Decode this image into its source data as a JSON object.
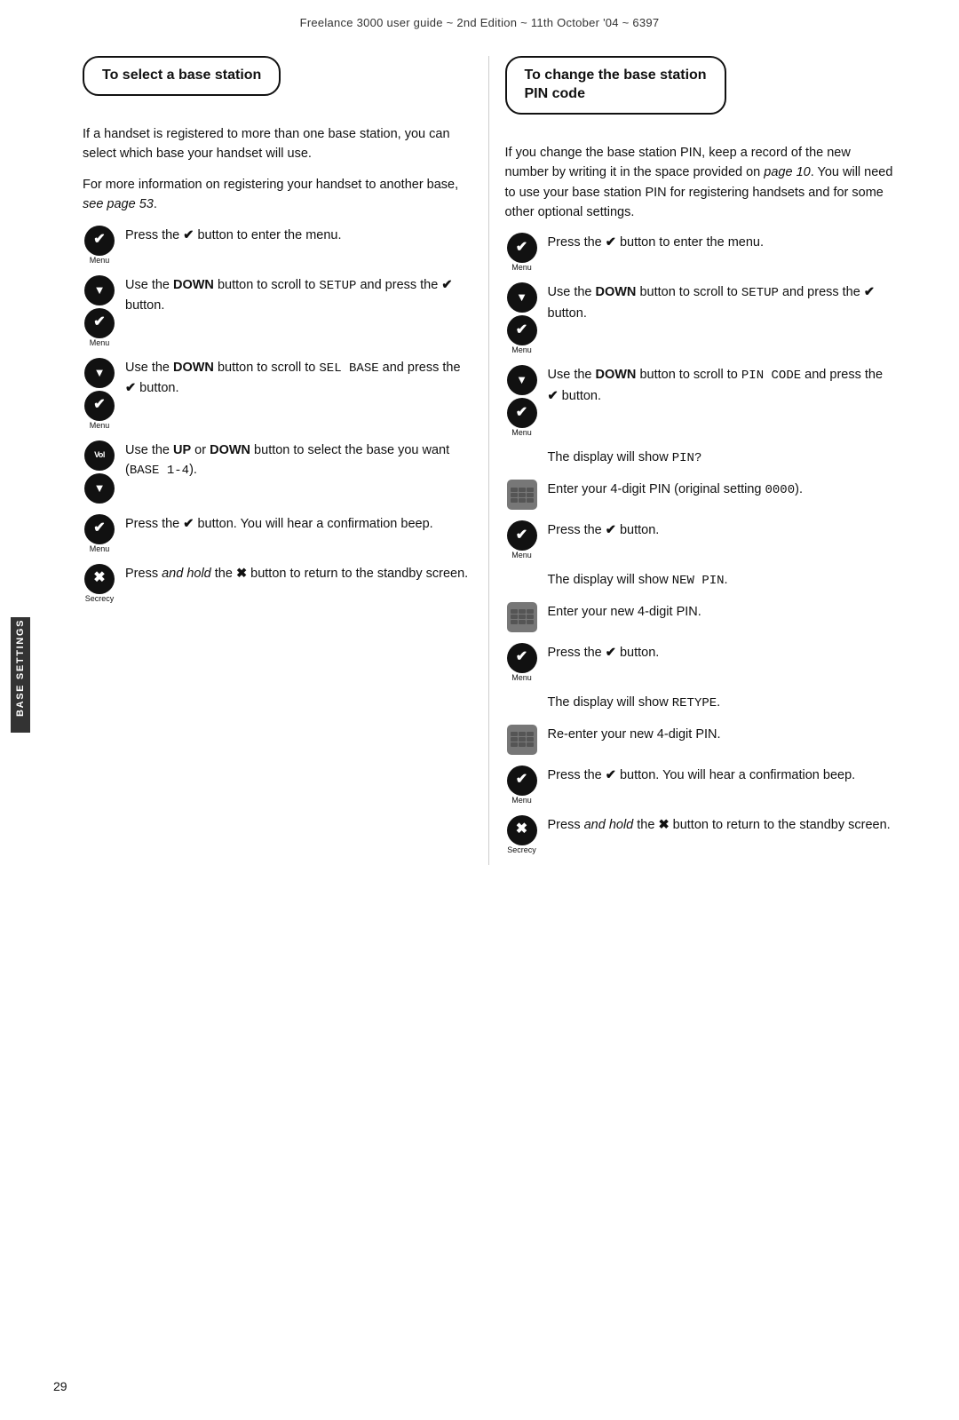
{
  "header": {
    "text": "Freelance 3000 user guide ~ 2nd Edition ~ 11th October '04 ~ 6397"
  },
  "side_tab": {
    "label": "BASE SETTINGS"
  },
  "page_number": "29",
  "left": {
    "title": "To select a base station",
    "intro1": "If a handset is registered to more than one base station, you can select which base your handset will use.",
    "intro2": "For more information on registering your handset to another base, see page 53.",
    "steps": [
      {
        "icon": "checkmark",
        "label": "Menu",
        "text": "Press the ✔ button to enter the menu."
      },
      {
        "icon": "down+checkmark",
        "label": "Menu",
        "text": "Use the DOWN button to scroll to SETUP and press the ✔ button."
      },
      {
        "icon": "down+checkmark",
        "label": "Menu",
        "text": "Use the DOWN button to scroll to SEL BASE and press the ✔ button."
      },
      {
        "icon": "vol+down",
        "label": "",
        "text": "Use the UP or DOWN button to select the base you want (BASE 1-4)."
      },
      {
        "icon": "checkmark",
        "label": "Menu",
        "text": "Press the ✔ button. You will hear a confirmation beep."
      },
      {
        "icon": "cross",
        "label": "Secrecy",
        "text": "Press and hold the ✖ button to return to the standby screen."
      }
    ],
    "see_page": "see page 53",
    "step2_mono": "SETUP",
    "step3_mono": "SEL BASE",
    "step4_mono": "BASE 1-4"
  },
  "right": {
    "title": "To change the base station PIN code",
    "intro": "If you change the base station PIN, keep a record of the new number by writing it in the space provided on page 10. You will need to use your base station PIN for registering handsets and for some other optional settings.",
    "steps": [
      {
        "icon": "checkmark",
        "label": "Menu",
        "text": "Press the ✔ button to enter the menu."
      },
      {
        "icon": "down+checkmark",
        "label": "Menu",
        "text": "Use the DOWN button to scroll to SETUP and press the ✔ button."
      },
      {
        "icon": "down+checkmark",
        "label": "Menu",
        "text": "Use the DOWN button to scroll to PIN CODE and press the ✔ button."
      },
      {
        "icon": "none",
        "label": "",
        "text": "The display will show PIN?"
      },
      {
        "icon": "keypad",
        "label": "",
        "text": "Enter your 4-digit PIN (original setting 0000)."
      },
      {
        "icon": "checkmark",
        "label": "Menu",
        "text": "Press the ✔ button."
      },
      {
        "icon": "none",
        "label": "",
        "text": "The display will show NEW PIN."
      },
      {
        "icon": "keypad",
        "label": "",
        "text": "Enter your new 4-digit PIN."
      },
      {
        "icon": "checkmark",
        "label": "Menu",
        "text": "Press the ✔ button."
      },
      {
        "icon": "none",
        "label": "",
        "text": "The display will show RETYPE."
      },
      {
        "icon": "keypad",
        "label": "",
        "text": "Re-enter your new 4-digit PIN."
      },
      {
        "icon": "checkmark",
        "label": "Menu",
        "text": "Press the ✔ button. You will hear a confirmation beep."
      },
      {
        "icon": "cross",
        "label": "Secrecy",
        "text": "Press and hold the ✖ button to return to the standby screen."
      }
    ]
  }
}
